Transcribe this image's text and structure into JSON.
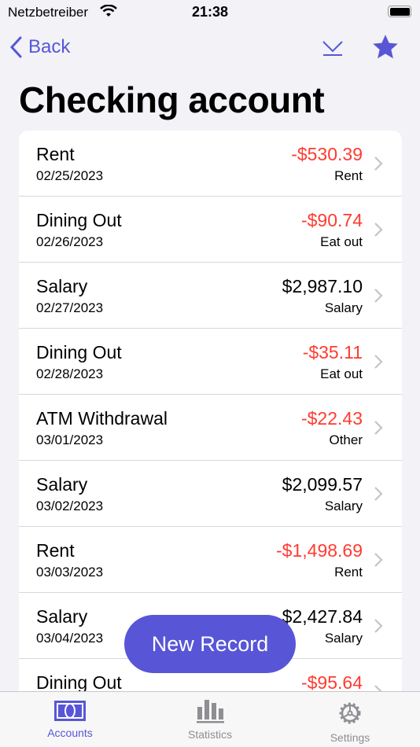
{
  "status": {
    "carrier": "Netzbetreiber",
    "time": "21:38"
  },
  "nav": {
    "back_label": "Back"
  },
  "title": "Checking account",
  "records": [
    {
      "title": "Rent",
      "date": "02/25/2023",
      "amount": "-$530.39",
      "category": "Rent",
      "negative": true
    },
    {
      "title": "Dining Out",
      "date": "02/26/2023",
      "amount": "-$90.74",
      "category": "Eat out",
      "negative": true
    },
    {
      "title": "Salary",
      "date": "02/27/2023",
      "amount": "$2,987.10",
      "category": "Salary",
      "negative": false
    },
    {
      "title": "Dining Out",
      "date": "02/28/2023",
      "amount": "-$35.11",
      "category": "Eat out",
      "negative": true
    },
    {
      "title": "ATM Withdrawal",
      "date": "03/01/2023",
      "amount": "-$22.43",
      "category": "Other",
      "negative": true
    },
    {
      "title": "Salary",
      "date": "03/02/2023",
      "amount": "$2,099.57",
      "category": "Salary",
      "negative": false
    },
    {
      "title": "Rent",
      "date": "03/03/2023",
      "amount": "-$1,498.69",
      "category": "Rent",
      "negative": true
    },
    {
      "title": "Salary",
      "date": "03/04/2023",
      "amount": "$2,427.84",
      "category": "Salary",
      "negative": false
    },
    {
      "title": "Dining Out",
      "date": "",
      "amount": "-$95.64",
      "category": "",
      "negative": true
    }
  ],
  "fab_label": "New Record",
  "tabs": [
    {
      "label": "Accounts",
      "icon": "accounts-icon",
      "active": true
    },
    {
      "label": "Statistics",
      "icon": "chart-icon",
      "active": false
    },
    {
      "label": "Settings",
      "icon": "gear-icon",
      "active": false
    }
  ],
  "colors": {
    "accent": "#5856d6",
    "negative": "#ff3b30",
    "background": "#f2f2f7"
  }
}
